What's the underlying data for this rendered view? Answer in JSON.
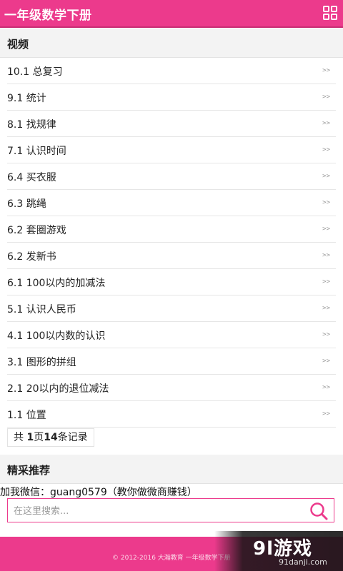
{
  "header": {
    "title": "一年级数学下册",
    "menu_icon": "grid-icon"
  },
  "videos": {
    "heading": "视频",
    "arrow": ">>",
    "items": [
      {
        "label": "10.1 总复习"
      },
      {
        "label": "9.1 统计"
      },
      {
        "label": "8.1 找规律"
      },
      {
        "label": "7.1 认识时间"
      },
      {
        "label": "6.4 买衣服"
      },
      {
        "label": "6.3 跳绳"
      },
      {
        "label": "6.2 套圈游戏"
      },
      {
        "label": "6.2 发新书"
      },
      {
        "label": "6.1 100以内的加减法"
      },
      {
        "label": "5.1 认识人民币"
      },
      {
        "label": "4.1 100以内数的认识"
      },
      {
        "label": "3.1 图形的拼组"
      },
      {
        "label": "2.1 20以内的退位减法"
      },
      {
        "label": "1.1 位置"
      }
    ]
  },
  "pager": {
    "prefix": "共 ",
    "pages": "1",
    "mid": "页",
    "records": "14",
    "suffix": "条记录"
  },
  "recommend": {
    "heading": "精采推荐",
    "promo_text": "加我微信：guang0579（教你做微商赚钱）"
  },
  "search": {
    "placeholder": "在这里搜索...",
    "icon": "search-icon"
  },
  "footer": {
    "copyright": "© 2012-2016 大瀚教育  一年级数学下册"
  },
  "watermark": {
    "brand": "9l游戏",
    "url": "91danji.com"
  },
  "colors": {
    "accent": "#ec3a8c",
    "section_bg": "#f3f3f3"
  }
}
